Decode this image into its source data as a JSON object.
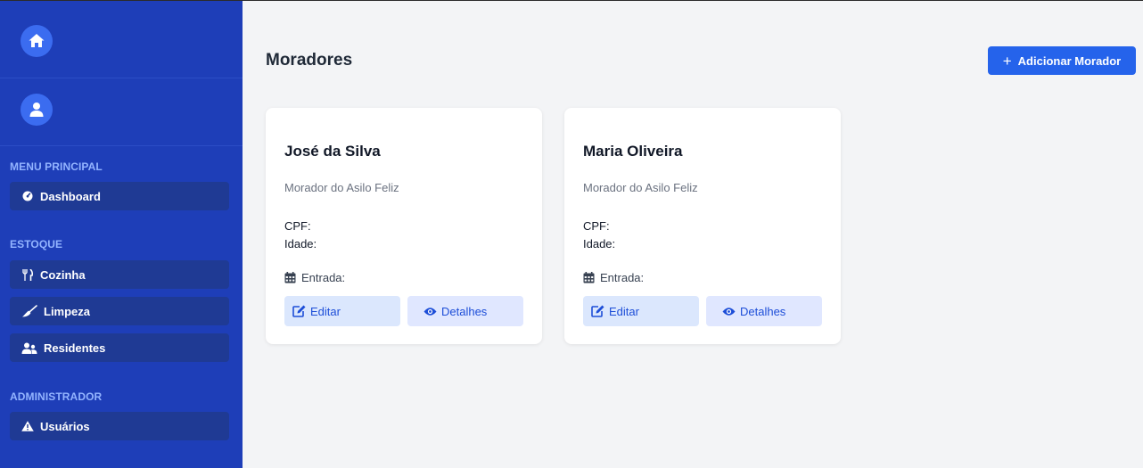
{
  "page": {
    "title": "Moradores",
    "add_button": "Adicionar Morador"
  },
  "sidebar": {
    "sections": [
      {
        "title": "MENU PRINCIPAL",
        "items": [
          {
            "label": "Dashboard",
            "icon": "gauge-icon"
          }
        ]
      },
      {
        "title": "ESTOQUE",
        "items": [
          {
            "label": "Cozinha",
            "icon": "utensils-icon"
          },
          {
            "label": "Limpeza",
            "icon": "broom-icon"
          },
          {
            "label": "Residentes",
            "icon": "users-icon"
          }
        ]
      },
      {
        "title": "ADMINISTRADOR",
        "items": [
          {
            "label": "Usuários",
            "icon": "warning-icon"
          }
        ]
      }
    ]
  },
  "residents": [
    {
      "name": "José da Silva",
      "subtitle": "Morador do Asilo Feliz",
      "cpf_label": "CPF:",
      "idade_label": "Idade:",
      "entrada_label": "Entrada:",
      "edit_label": "Editar",
      "details_label": "Detalhes"
    },
    {
      "name": "Maria Oliveira",
      "subtitle": "Morador do Asilo Feliz",
      "cpf_label": "CPF:",
      "idade_label": "Idade:",
      "entrada_label": "Entrada:",
      "edit_label": "Editar",
      "details_label": "Detalhes"
    }
  ],
  "colors": {
    "sidebar_bg": "#1e3eb8",
    "nav_item_bg": "#1f3a94",
    "section_title": "#93b4ff",
    "accent": "#2563eb",
    "page_bg": "#f3f4f6"
  }
}
